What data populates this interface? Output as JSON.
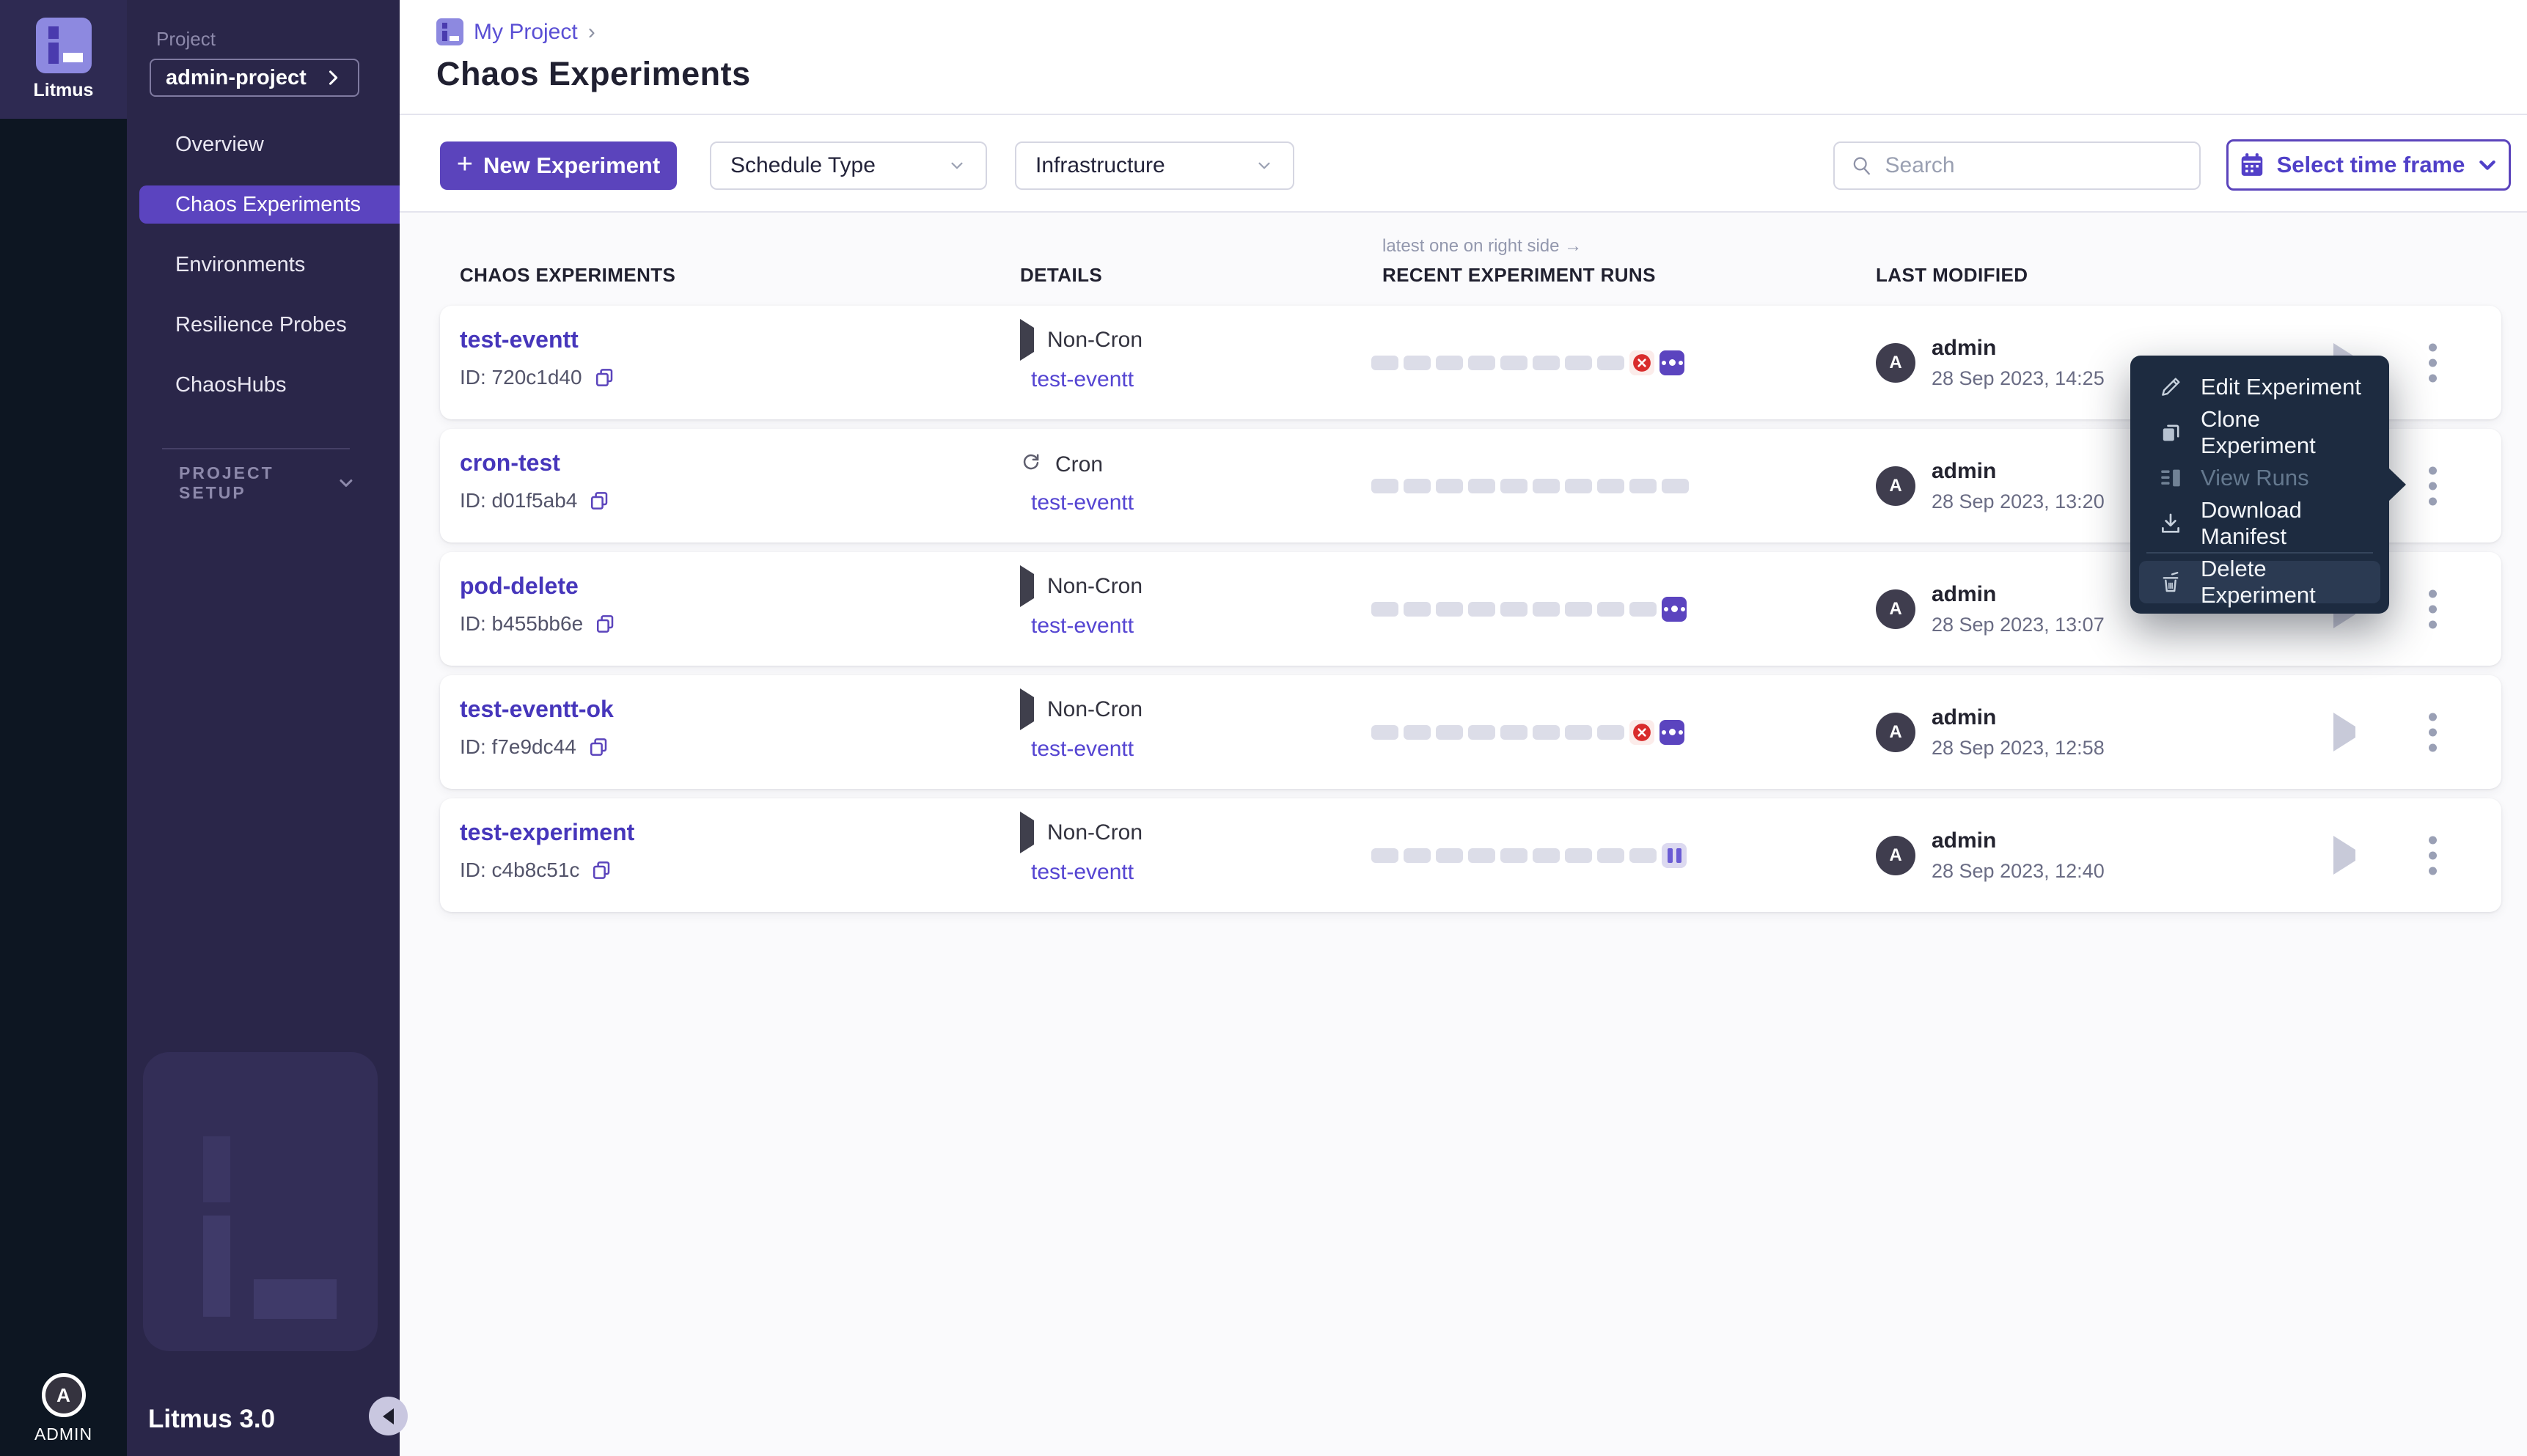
{
  "brand": {
    "name": "Litmus",
    "version": "Litmus 3.0"
  },
  "user": {
    "initial": "A",
    "role": "ADMIN"
  },
  "sidebar": {
    "project_label": "Project",
    "project_name": "admin-project",
    "nav": [
      "Overview",
      "Chaos Experiments",
      "Environments",
      "Resilience Probes",
      "ChaosHubs"
    ],
    "active_item": "Chaos Experiments",
    "project_setup": "PROJECT SETUP"
  },
  "header": {
    "breadcrumb_project": "My Project",
    "breadcrumb_separator": "›",
    "title": "Chaos Experiments"
  },
  "toolbar": {
    "new_experiment": "New Experiment",
    "schedule_type": "Schedule Type",
    "infrastructure": "Infrastructure",
    "search_placeholder": "Search",
    "time_frame": "Select time frame"
  },
  "table": {
    "runs_note": "latest one on right side →",
    "headers": [
      "CHAOS EXPERIMENTS",
      "DETAILS",
      "RECENT EXPERIMENT RUNS",
      "LAST MODIFIED"
    ],
    "rows": [
      {
        "name": "test-eventt",
        "id": "ID: 720c1d40",
        "schedule": "Non-Cron",
        "schedule_icon": "play",
        "link": "test-eventt",
        "runs": {
          "placeholders": 8,
          "statuses": [
            "failed",
            "running"
          ]
        },
        "modified_by": "admin",
        "modified_at": "28 Sep 2023, 14:25"
      },
      {
        "name": "cron-test",
        "id": "ID: d01f5ab4",
        "schedule": "Cron",
        "schedule_icon": "cron",
        "link": "test-eventt",
        "runs": {
          "placeholders": 10,
          "statuses": []
        },
        "modified_by": "admin",
        "modified_at": "28 Sep 2023, 13:20"
      },
      {
        "name": "pod-delete",
        "id": "ID: b455bb6e",
        "schedule": "Non-Cron",
        "schedule_icon": "play",
        "link": "test-eventt",
        "runs": {
          "placeholders": 9,
          "statuses": [
            "running"
          ]
        },
        "modified_by": "admin",
        "modified_at": "28 Sep 2023, 13:07"
      },
      {
        "name": "test-eventt-ok",
        "id": "ID: f7e9dc44",
        "schedule": "Non-Cron",
        "schedule_icon": "play",
        "link": "test-eventt",
        "runs": {
          "placeholders": 8,
          "statuses": [
            "failed",
            "running"
          ]
        },
        "modified_by": "admin",
        "modified_at": "28 Sep 2023, 12:58"
      },
      {
        "name": "test-experiment",
        "id": "ID: c4b8c51c",
        "schedule": "Non-Cron",
        "schedule_icon": "play",
        "link": "test-eventt",
        "runs": {
          "placeholders": 9,
          "statuses": [
            "paused"
          ]
        },
        "modified_by": "admin",
        "modified_at": "28 Sep 2023, 12:40"
      }
    ]
  },
  "context_menu": {
    "items": [
      {
        "label": "Edit Experiment",
        "icon": "pencil-icon",
        "disabled": false,
        "highlighted": false
      },
      {
        "label": "Clone Experiment",
        "icon": "clone-icon",
        "disabled": false,
        "highlighted": false
      },
      {
        "label": "View Runs",
        "icon": "runs-icon",
        "disabled": true,
        "highlighted": false
      },
      {
        "label": "Download Manifest",
        "icon": "download-icon",
        "disabled": false,
        "highlighted": false
      },
      {
        "label": "Delete Experiment",
        "icon": "trash-icon",
        "disabled": false,
        "highlighted": true
      }
    ]
  },
  "colors": {
    "primary_purple": "#5b44bc",
    "link_purple": "#5545d2",
    "name_purple": "#4636bb",
    "sidebar_bg": "#2a2649",
    "rail_bg": "#0d1622",
    "menu_bg": "#1d2b40",
    "failed_red": "#d92c2c",
    "failed_bg": "#fcecea",
    "paused_bg": "#dcd9f0",
    "run_placeholder": "#dcdde8"
  }
}
